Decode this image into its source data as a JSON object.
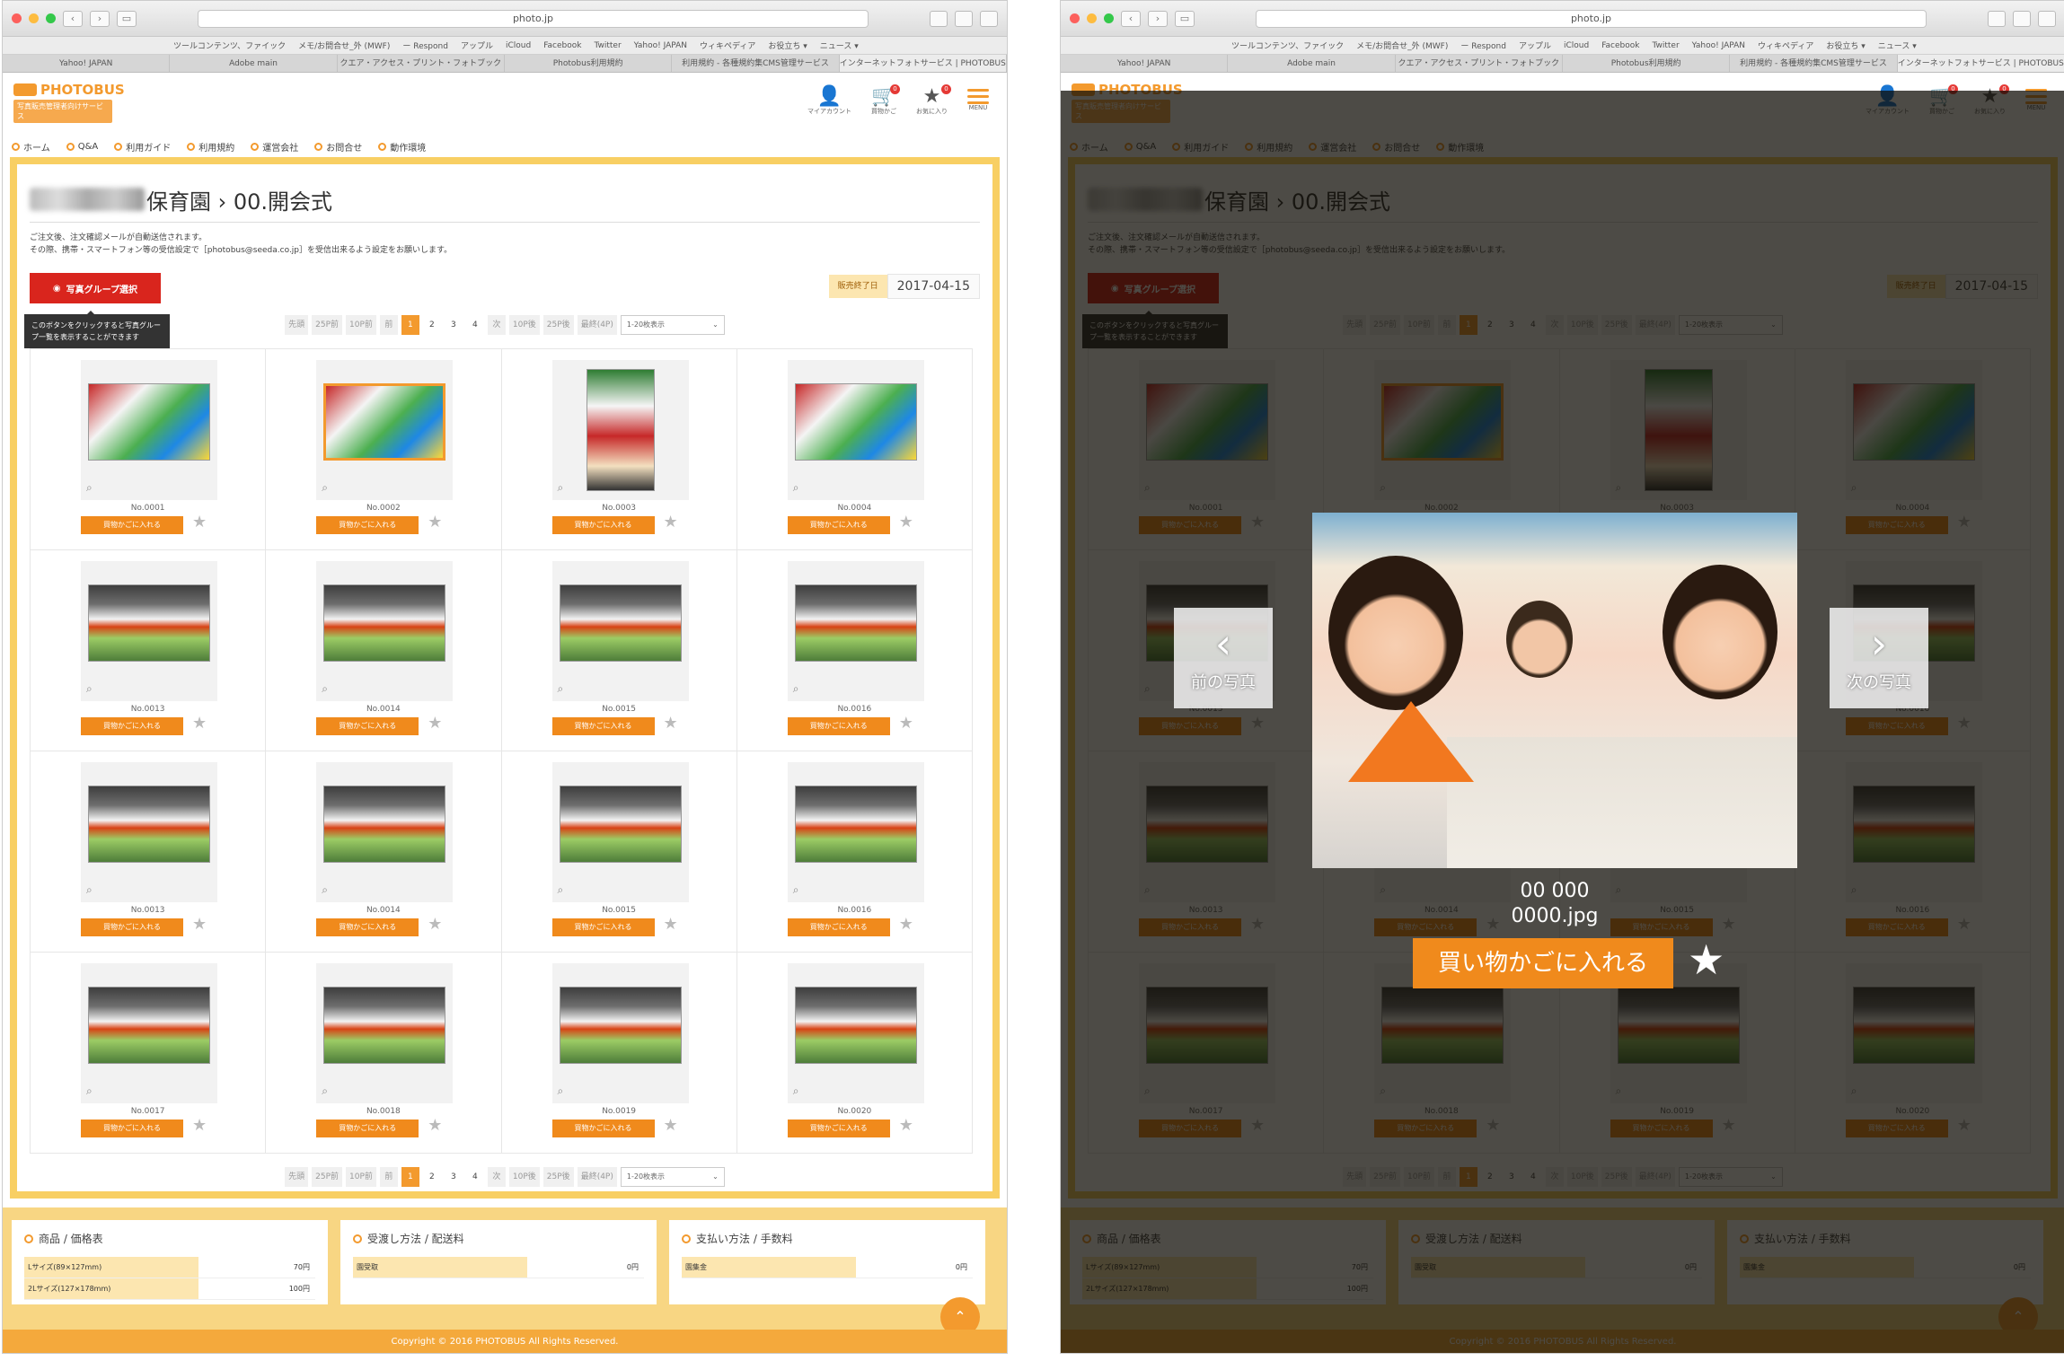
{
  "browser": {
    "url": "photo.jp",
    "bookmarks": [
      "ツールコンテンツ、ファイック",
      "メモ/お問合せ_外 (MWF)",
      "ー Respond",
      "アップル",
      "iCloud",
      "Facebook",
      "Twitter",
      "Yahoo! JAPAN",
      "ウィキペディア",
      "お役立ち ▾",
      "ニュース ▾"
    ],
    "tabs": [
      "Yahoo! JAPAN",
      "Adobe main",
      "クエア・アクセス・プリント・フォトブック",
      "Photobus利用規約",
      "利用規約 - 各種規約集CMS管理サービス",
      "インターネットフォトサービス | PHOTOBUS"
    ]
  },
  "site": {
    "logo": "PHOTOBUS",
    "logo_sub": "写真販売管理者向けサービス",
    "icons": [
      {
        "name": "mypage-icon",
        "glyph": "👤",
        "label": "マイアカウント",
        "badge": ""
      },
      {
        "name": "cart-icon",
        "glyph": "🛒",
        "label": "買物かご",
        "badge": "0"
      },
      {
        "name": "favorite-icon",
        "glyph": "★",
        "label": "お気に入り",
        "badge": "0"
      }
    ],
    "menu_label": "MENU",
    "nav": [
      "ホーム",
      "Q&A",
      "利用ガイド",
      "利用規約",
      "運営会社",
      "お問合せ",
      "動作環境"
    ]
  },
  "page": {
    "title_suffix": "保育園 › 00.開会式",
    "notice_line1": "ご注文後、注文確認メールが自動送信されます。",
    "notice_line2": "その際、携帯・スマートフォン等の受信設定で［photobus@seeda.co.jp］を受信出来るよう設定をお願いします。",
    "group_button": "写真グループ選択",
    "tooltip": "このボタンをクリックすると写真グループ一覧を表示することができます",
    "date_label": "販売終了日",
    "date_value": "2017-04-15"
  },
  "pager": {
    "items": [
      {
        "t": "先頭",
        "k": "pg"
      },
      {
        "t": "25P前",
        "k": "pg"
      },
      {
        "t": "10P前",
        "k": "pg"
      },
      {
        "t": "前",
        "k": "pg"
      },
      {
        "t": "1",
        "k": "cur"
      },
      {
        "t": "2",
        "k": "num"
      },
      {
        "t": "3",
        "k": "num"
      },
      {
        "t": "4",
        "k": "num"
      },
      {
        "t": "次",
        "k": "pg"
      },
      {
        "t": "10P後",
        "k": "pg"
      },
      {
        "t": "25P後",
        "k": "pg"
      },
      {
        "t": "最終(4P)",
        "k": "pg"
      }
    ],
    "per_page": "1-20枚表示"
  },
  "photos": [
    {
      "no": "No.0001",
      "kind": "decor"
    },
    {
      "no": "No.0002",
      "kind": "decor-sel"
    },
    {
      "no": "No.0003",
      "kind": "decor-tall"
    },
    {
      "no": "No.0004",
      "kind": "decor"
    },
    {
      "no": "No.0013",
      "kind": "crowd"
    },
    {
      "no": "No.0014",
      "kind": "crowd"
    },
    {
      "no": "No.0015",
      "kind": "crowd"
    },
    {
      "no": "No.0016",
      "kind": "crowd"
    },
    {
      "no": "No.0013",
      "kind": "crowd"
    },
    {
      "no": "No.0014",
      "kind": "crowd"
    },
    {
      "no": "No.0015",
      "kind": "crowd"
    },
    {
      "no": "No.0016",
      "kind": "crowd"
    },
    {
      "no": "No.0017",
      "kind": "crowd"
    },
    {
      "no": "No.0018",
      "kind": "crowd"
    },
    {
      "no": "No.0019",
      "kind": "crowd"
    },
    {
      "no": "No.0020",
      "kind": "crowd"
    }
  ],
  "cart_label": "買物かごに入れる",
  "footer": {
    "boxes": [
      {
        "title": "商品 / 価格表",
        "rows": [
          {
            "k": "Lサイズ(89×127mm)",
            "v": "70円"
          },
          {
            "k": "2Lサイズ(127×178mm)",
            "v": "100円"
          }
        ]
      },
      {
        "title": "受渡し方法 / 配送料",
        "rows": [
          {
            "k": "園受取",
            "v": "0円"
          }
        ]
      },
      {
        "title": "支払い方法 / 手数料",
        "rows": [
          {
            "k": "園集金",
            "v": "0円"
          }
        ]
      }
    ],
    "copyright": "Copyright © 2016 PHOTOBUS All Rights Reserved."
  },
  "lightbox": {
    "prev_label": "前の写真",
    "next_label": "次の写真",
    "filename_line1": "00 000",
    "filename_line2": "0000.jpg",
    "cart_button": "買い物かごに入れる"
  },
  "colors": {
    "accent": "#f39a2e",
    "cart": "#f08a1c",
    "group_button": "#d9251d",
    "frame": "#f8cf63"
  }
}
